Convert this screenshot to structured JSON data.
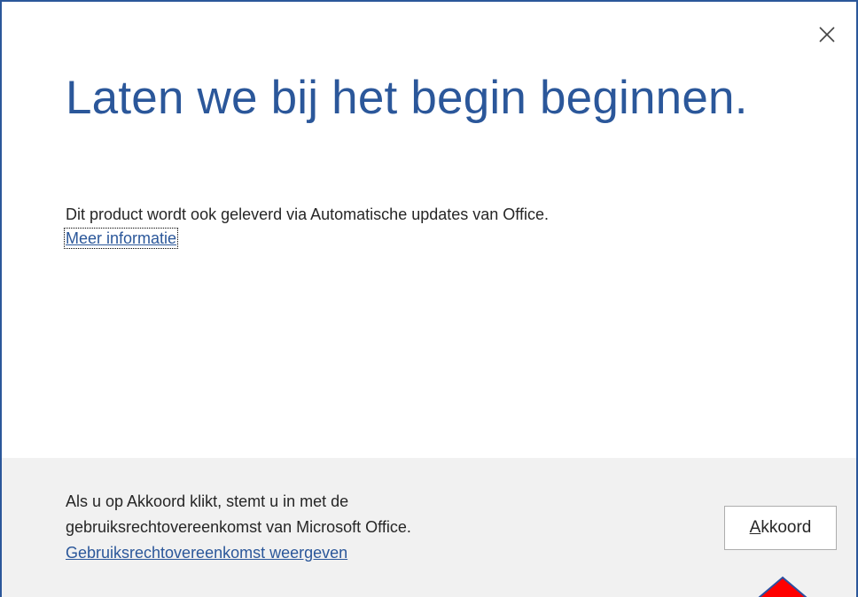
{
  "dialog": {
    "title": "Laten we bij het begin beginnen.",
    "info_text": "Dit product wordt ook geleverd via Automatische updates van Office.",
    "info_link": "Meer informatie",
    "footer_line1": "Als u op Akkoord klikt, stemt u in met de",
    "footer_line2": "gebruiksrechtovereenkomst van Microsoft Office.",
    "footer_link": "Gebruiksrechtovereenkomst weergeven",
    "accept_button": {
      "accesskey": "A",
      "rest": "kkoord"
    }
  },
  "icons": {
    "close": "close-icon",
    "cursor": "mouse-pointer-icon"
  },
  "colors": {
    "accent": "#2b579a",
    "footer_bg": "#f1f1f1",
    "text": "#262626",
    "cursor": "#ff0000"
  }
}
